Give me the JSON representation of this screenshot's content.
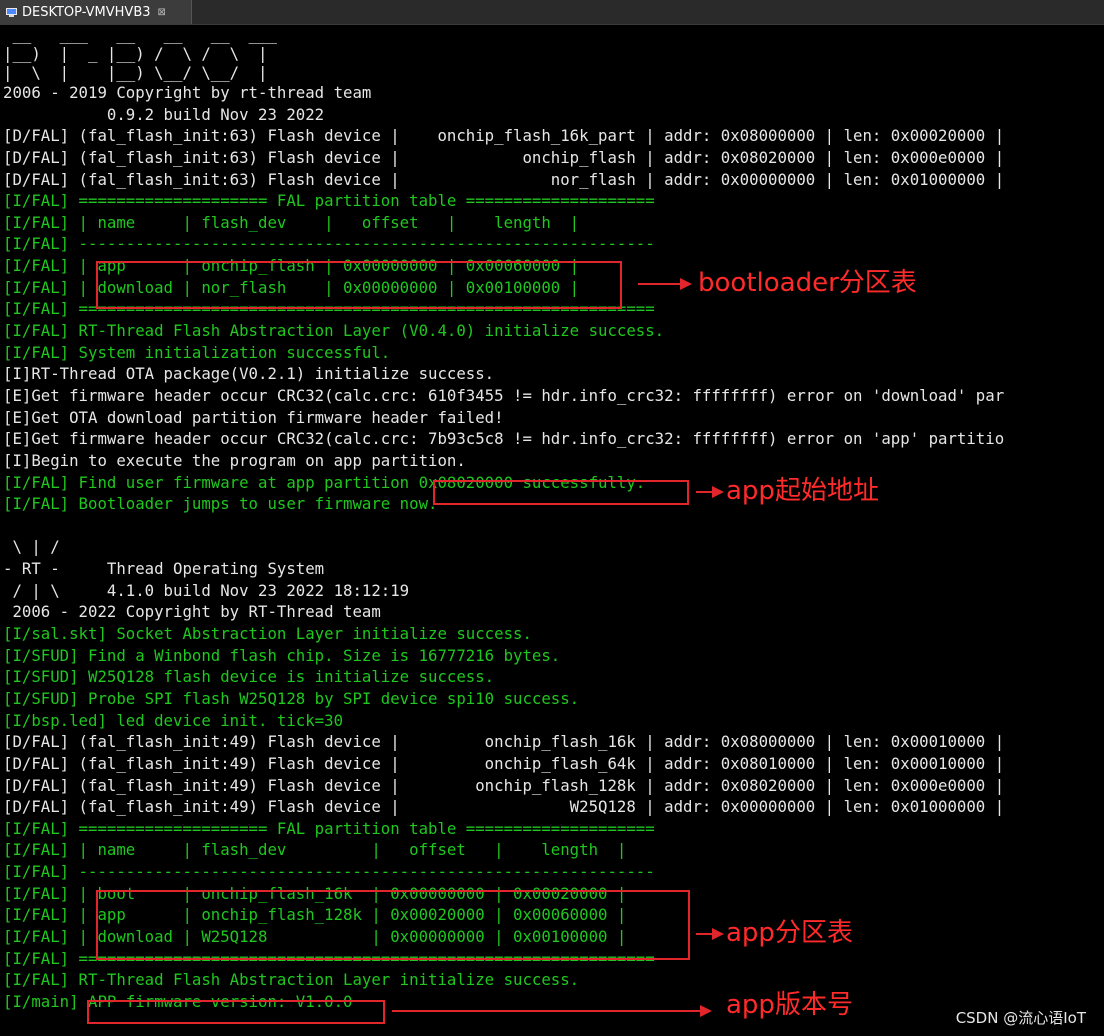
{
  "window": {
    "tab_title": "DESKTOP-VMVHVB3",
    "tab_close": "⊠",
    "tab_icon": "monitor-icon"
  },
  "colors": {
    "background": "#000000",
    "text_white": "#e6e6e6",
    "text_green": "#1fc71f",
    "annotation_red": "#e0262b"
  },
  "ascii_art": [
    " __   ___   __   __   __  ___",
    "|__)  |  _ |__) /  \\ /  \\  |",
    "|  \\  |    |__) \\__/ \\__/  |"
  ],
  "lines": [
    {
      "t": "2006 - 2019 Copyright by rt-thread team",
      "c": "white"
    },
    {
      "t": "           0.9.2 build Nov 23 2022",
      "c": "white"
    },
    {
      "t": "[D/FAL] (fal_flash_init:63) Flash device |    onchip_flash_16k_part | addr: 0x08000000 | len: 0x00020000 |",
      "c": "white"
    },
    {
      "t": "[D/FAL] (fal_flash_init:63) Flash device |             onchip_flash | addr: 0x08020000 | len: 0x000e0000 |",
      "c": "white"
    },
    {
      "t": "[D/FAL] (fal_flash_init:63) Flash device |                nor_flash | addr: 0x00000000 | len: 0x01000000 |",
      "c": "white"
    },
    {
      "t": "[I/FAL] ==================== FAL partition table ====================",
      "c": "green"
    },
    {
      "t": "[I/FAL] | name     | flash_dev    |   offset   |    length  |",
      "c": "green"
    },
    {
      "t": "[I/FAL] -------------------------------------------------------------",
      "c": "green"
    },
    {
      "t": "[I/FAL] | app      | onchip_flash | 0x00000000 | 0x00060000 |",
      "c": "green"
    },
    {
      "t": "[I/FAL] | download | nor_flash    | 0x00000000 | 0x00100000 |",
      "c": "green"
    },
    {
      "t": "[I/FAL] =============================================================",
      "c": "green"
    },
    {
      "t": "[I/FAL] RT-Thread Flash Abstraction Layer (V0.4.0) initialize success.",
      "c": "green"
    },
    {
      "t": "[I/FAL] System initialization successful.",
      "c": "green"
    },
    {
      "t": "[I]RT-Thread OTA package(V0.2.1) initialize success.",
      "c": "white"
    },
    {
      "t": "[E]Get firmware header occur CRC32(calc.crc: 610f3455 != hdr.info_crc32: ffffffff) error on 'download' par",
      "c": "white"
    },
    {
      "t": "[E]Get OTA download partition firmware header failed!",
      "c": "white"
    },
    {
      "t": "[E]Get firmware header occur CRC32(calc.crc: 7b93c5c8 != hdr.info_crc32: ffffffff) error on 'app' partitio",
      "c": "white"
    },
    {
      "t": "[I]Begin to execute the program on app partition.",
      "c": "white"
    },
    {
      "t": "[I/FAL] Find user firmware at app partition 0x08020000 successfully.",
      "c": "green"
    },
    {
      "t": "[I/FAL] Bootloader jumps to user firmware now.",
      "c": "green"
    },
    {
      "t": "",
      "c": "white"
    },
    {
      "t": " \\ | /",
      "c": "white"
    },
    {
      "t": "- RT -     Thread Operating System",
      "c": "white"
    },
    {
      "t": " / | \\     4.1.0 build Nov 23 2022 18:12:19",
      "c": "white"
    },
    {
      "t": " 2006 - 2022 Copyright by RT-Thread team",
      "c": "white"
    },
    {
      "t": "[I/sal.skt] Socket Abstraction Layer initialize success.",
      "c": "green"
    },
    {
      "t": "[I/SFUD] Find a Winbond flash chip. Size is 16777216 bytes.",
      "c": "green"
    },
    {
      "t": "[I/SFUD] W25Q128 flash device is initialize success.",
      "c": "green"
    },
    {
      "t": "[I/SFUD] Probe SPI flash W25Q128 by SPI device spi10 success.",
      "c": "green"
    },
    {
      "t": "[I/bsp.led] led device init. tick=30",
      "c": "green"
    },
    {
      "t": "[D/FAL] (fal_flash_init:49) Flash device |         onchip_flash_16k | addr: 0x08000000 | len: 0x00010000 |",
      "c": "white"
    },
    {
      "t": "[D/FAL] (fal_flash_init:49) Flash device |         onchip_flash_64k | addr: 0x08010000 | len: 0x00010000 |",
      "c": "white"
    },
    {
      "t": "[D/FAL] (fal_flash_init:49) Flash device |        onchip_flash_128k | addr: 0x08020000 | len: 0x000e0000 |",
      "c": "white"
    },
    {
      "t": "[D/FAL] (fal_flash_init:49) Flash device |                  W25Q128 | addr: 0x00000000 | len: 0x01000000 |",
      "c": "white"
    },
    {
      "t": "[I/FAL] ==================== FAL partition table ====================",
      "c": "green"
    },
    {
      "t": "[I/FAL] | name     | flash_dev         |   offset   |    length  |",
      "c": "green"
    },
    {
      "t": "[I/FAL] -------------------------------------------------------------",
      "c": "green"
    },
    {
      "t": "[I/FAL] | boot     | onchip_flash_16k  | 0x00000000 | 0x00020000 |",
      "c": "green"
    },
    {
      "t": "[I/FAL] | app      | onchip_flash_128k | 0x00020000 | 0x00060000 |",
      "c": "green"
    },
    {
      "t": "[I/FAL] | download | W25Q128           | 0x00000000 | 0x00100000 |",
      "c": "green"
    },
    {
      "t": "[I/FAL] =============================================================",
      "c": "green"
    },
    {
      "t": "[I/FAL] RT-Thread Flash Abstraction Layer initialize success.",
      "c": "green"
    },
    {
      "t": "[I/main] APP firmware version: V1.0.0",
      "c": "green"
    }
  ],
  "annotations": {
    "bootloader_table": "bootloader分区表",
    "app_start": "app起始地址",
    "app_table": "app分区表",
    "app_version": "app版本号"
  },
  "watermark": "CSDN @流心语IoT"
}
